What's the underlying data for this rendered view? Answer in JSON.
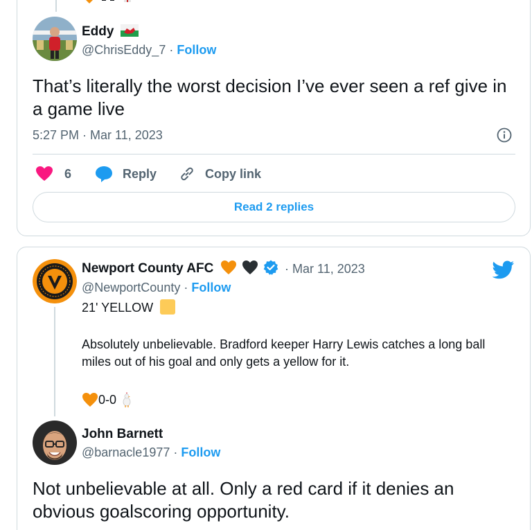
{
  "reply_tweet": {
    "author_name": "Eddy",
    "author_flag_icon": "wales-flag-icon",
    "handle": "@ChrisEddy_7",
    "follow_label": "Follow",
    "text": "That’s literally the worst decision I’ve ever seen a ref give in a game live",
    "timestamp": "5:27 PM · Mar 11, 2023",
    "likes_count": "6",
    "reply_label": "Reply",
    "copy_link_label": "Copy link",
    "read_replies_label": "Read 2 replies"
  },
  "main_tweet": {
    "author_name": "Newport County AFC",
    "handle": "@NewportCounty",
    "follow_label": "Follow",
    "date": "Mar 11, 2023",
    "line1": "21' YELLOW",
    "body": "Absolutely unbelievable. Bradford keeper Harry Lewis catches a long ball miles out of his goal and only gets a yellow for it.",
    "score": "0-0",
    "colors": {
      "accent": "#1d9bf0",
      "heart": "#f91880",
      "amber": "#f4900c"
    }
  },
  "nested_reply": {
    "author_name": "John Barnett",
    "handle": "@barnacle1977",
    "follow_label": "Follow",
    "text": "Not unbelievable at all. Only a red card if it denies an obvious goalscoring opportunity."
  },
  "separators": {
    "dot": "·"
  }
}
